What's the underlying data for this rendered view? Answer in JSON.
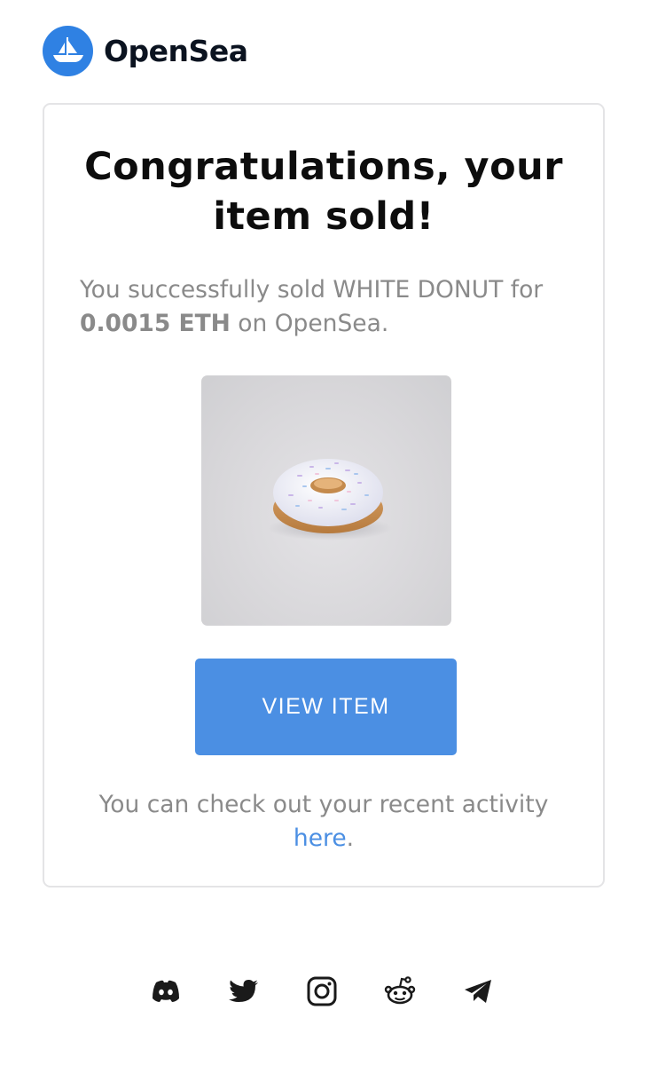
{
  "brand": {
    "name": "OpenSea"
  },
  "card": {
    "title_line1": "Congratulations, your",
    "title_line2": "item sold!",
    "subtitle_prefix": "You successfully sold WHITE DONUT for",
    "amount": "0.0015 ETH",
    "subtitle_suffix": " on OpenSea.",
    "button_label": "VIEW ITEM",
    "note_text": "You can check out your recent activity",
    "note_link": "here",
    "note_end": "."
  },
  "socials": [
    "discord-icon",
    "twitter-icon",
    "instagram-icon",
    "reddit-icon",
    "telegram-icon"
  ],
  "colors": {
    "brand_blue": "#2f81e3",
    "button_blue": "#4b8fe3",
    "muted_text": "#8a8a8a"
  }
}
